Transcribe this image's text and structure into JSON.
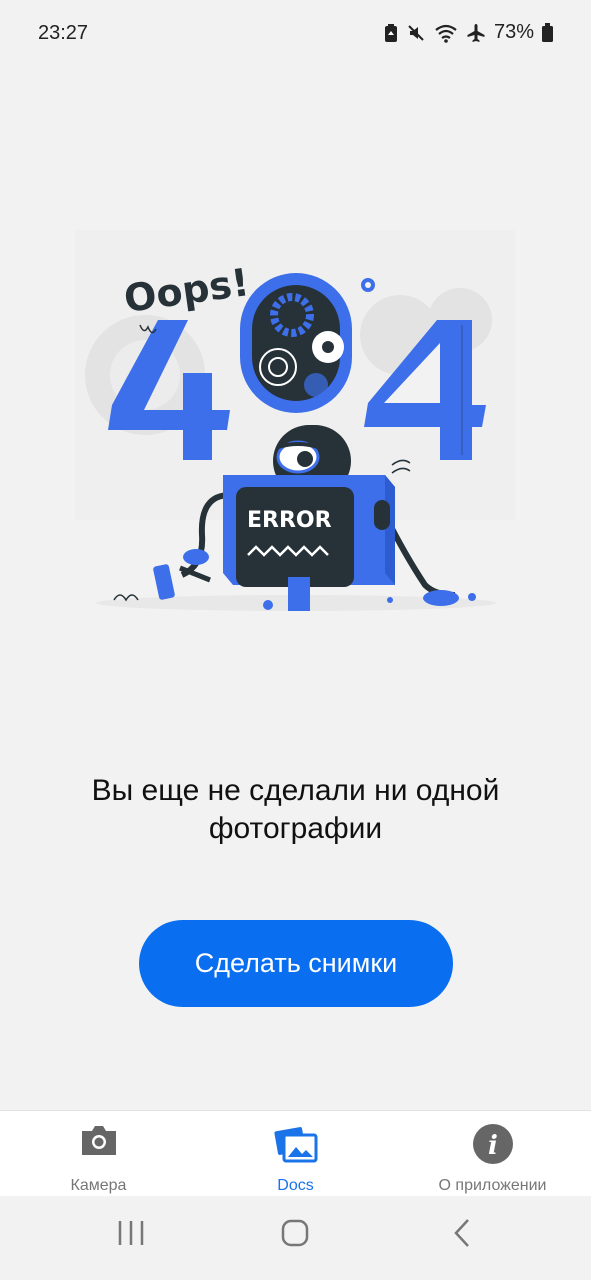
{
  "status_bar": {
    "time": "23:27",
    "battery": "73%",
    "icons": [
      "recycle-battery-icon",
      "mute-icon",
      "wifi-icon",
      "airplane-icon",
      "battery-icon"
    ]
  },
  "illustration": {
    "headline": "Oops!",
    "digits": "404",
    "screen_text": "ERROR"
  },
  "empty_state": {
    "message": "Вы еще не сделали ни одной фотографии",
    "button_label": "Сделать снимки"
  },
  "bottom_nav": {
    "items": [
      {
        "label": "Камера",
        "icon": "camera-icon",
        "active": false
      },
      {
        "label": "Docs",
        "icon": "gallery-icon",
        "active": true
      },
      {
        "label": "О приложении",
        "icon": "info-icon",
        "active": false
      }
    ]
  },
  "colors": {
    "accent": "#0a6ef0",
    "illustration_blue": "#3d6fea",
    "dark": "#263238",
    "background": "#f2f2f2"
  }
}
